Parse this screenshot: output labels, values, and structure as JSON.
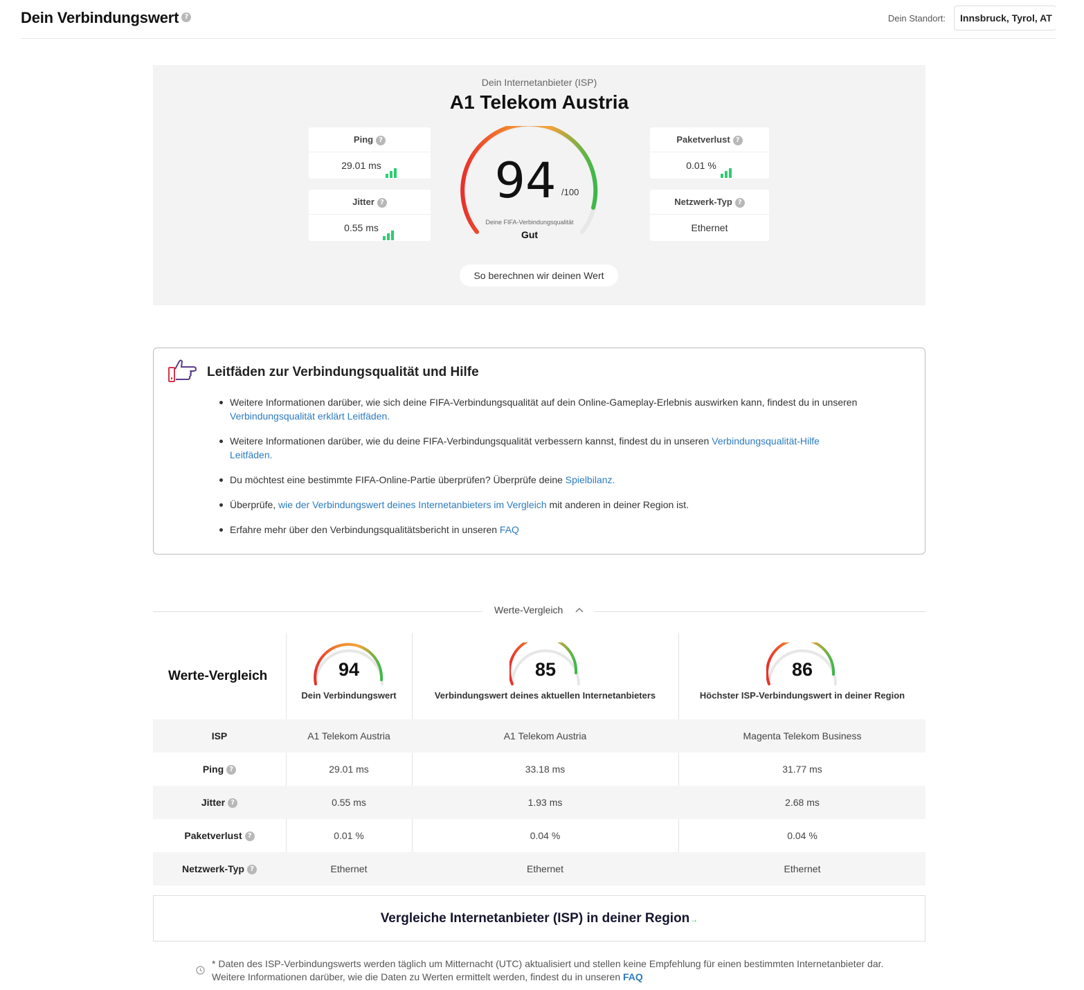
{
  "header": {
    "title": "Dein Verbindungswert",
    "location_label": "Dein Standort:",
    "location_value": "Innsbruck, Tyrol, AT"
  },
  "score_panel": {
    "isp_label": "Dein Internetanbieter (ISP)",
    "isp_name": "A1 Telekom Austria",
    "score": "94",
    "score_max": "/100",
    "quality_caption": "Deine FIFA-Verbindungsqualität",
    "quality": "Gut",
    "metrics": {
      "ping": {
        "label": "Ping",
        "value": "29.01 ms"
      },
      "jitter": {
        "label": "Jitter",
        "value": "0.55 ms"
      },
      "packet_loss": {
        "label": "Paketverlust",
        "value": "0.01 %"
      },
      "network_type": {
        "label": "Netzwerk-Typ",
        "value": "Ethernet"
      }
    },
    "calc_button": "So berechnen wir deinen Wert"
  },
  "guides": {
    "title": "Leitfäden zur Verbindungsqualität und Hilfe",
    "items": [
      {
        "text": "Weitere Informationen darüber, wie sich deine FIFA-Verbindungsqualität auf dein Online-Gameplay-Erlebnis auswirken kann, findest du in unseren ",
        "link": "Verbindungsqualität erklärt Leitfäden.",
        "after": ""
      },
      {
        "text": "Weitere Informationen darüber, wie du deine FIFA-Verbindungsqualität verbessern kannst, findest du in unseren ",
        "link": "Verbindungsqualität-Hilfe Leitfäden.",
        "after": ""
      },
      {
        "text": "Du möchtest eine bestimmte FIFA-Online-Partie überprüfen? Überprüfe deine ",
        "link": "Spielbilanz.",
        "after": ""
      },
      {
        "text": "Überprüfe, ",
        "link": "wie der Verbindungswert deines Internetanbieters im Vergleich",
        "after": " mit anderen in deiner Region ist."
      },
      {
        "text": "Erfahre mehr über den Verbindungsqualitätsbericht in unseren ",
        "link": "FAQ",
        "after": ""
      }
    ]
  },
  "comparison": {
    "toggle_label": "Werte-Vergleich",
    "title": "Werte-Vergleich",
    "columns": [
      {
        "score": "94",
        "label": "Dein Verbindungswert"
      },
      {
        "score": "85",
        "label": "Verbindungswert deines aktuellen Internetanbieters"
      },
      {
        "score": "86",
        "label": "Höchster ISP-Verbindungswert in deiner Region"
      }
    ],
    "rows": [
      {
        "label": "ISP",
        "values": [
          "A1 Telekom Austria",
          "A1 Telekom Austria",
          "Magenta Telekom Business"
        ]
      },
      {
        "label": "Ping",
        "values": [
          "29.01 ms",
          "33.18 ms",
          "31.77 ms"
        ]
      },
      {
        "label": "Jitter",
        "values": [
          "0.55 ms",
          "1.93 ms",
          "2.68 ms"
        ]
      },
      {
        "label": "Paketverlust",
        "values": [
          "0.01 %",
          "0.04 %",
          "0.04 %"
        ]
      },
      {
        "label": "Netzwerk-Typ",
        "values": [
          "Ethernet",
          "Ethernet",
          "Ethernet"
        ]
      }
    ]
  },
  "cta": {
    "label": "Vergleiche Internetanbieter (ISP) in deiner Region",
    "arrow": "→"
  },
  "footnote": {
    "text": "* Daten des ISP-Verbindungswerts werden täglich um Mitternacht (UTC) aktualisiert und stellen keine Empfehlung für einen bestimmten Internetanbieter dar. Weitere Informationen darüber, wie die Daten zu Werten ermittelt werden, findest du in unseren ",
    "link": "FAQ"
  },
  "icons": {
    "help": "?",
    "bars": "signal-bars-icon",
    "chevron": "chevron-up-icon",
    "clock": "clock-icon",
    "hand": "pointing-hand-icon"
  },
  "colors": {
    "accent_link": "#2d7bbf",
    "good": "#2ecc71",
    "gauge_low": "#e8302c",
    "gauge_mid": "#f2a23a",
    "gauge_high": "#3cb84a"
  }
}
